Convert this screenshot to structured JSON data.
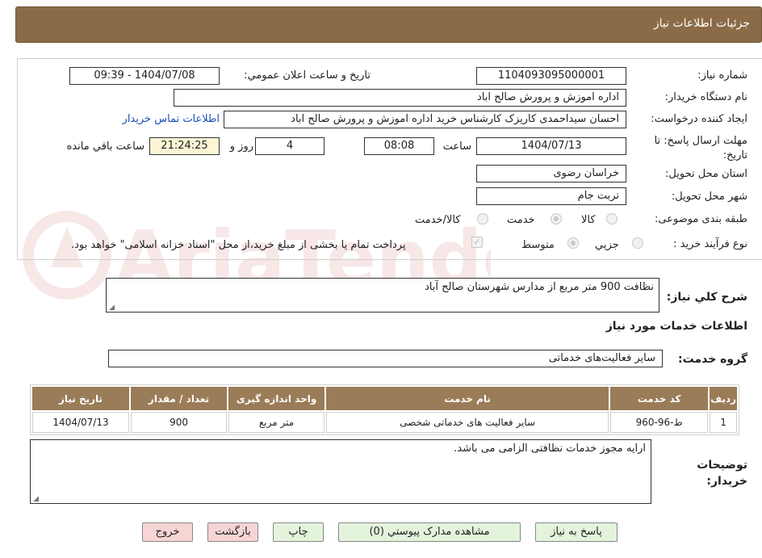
{
  "header": {
    "title": "جزئیات اطلاعات نیاز"
  },
  "labels": {
    "need_number": "شماره نیاز:",
    "announce_datetime": "تاریخ و ساعت اعلان عمومي:",
    "buyer_org": "نام دستگاه خريدار:",
    "requester": "ايجاد کننده درخواست:",
    "deadline": "مهلت ارسال پاسخ: تا تاریخ:",
    "hour": "ساعت",
    "day_and": "روز و",
    "remaining": "ساعت باقي مانده",
    "province": "استان محل تحويل:",
    "city": "شهر محل تحويل:",
    "category": "طبقه بندی موضوعی:",
    "purchase_type": "نوع فرآيند خريد :",
    "summary": "شرح کلي نياز:",
    "services_info": "اطلاعات خدمات مورد نياز",
    "service_group": "گروه خدمت:",
    "buyer_notes": "توضيحات خريدار:"
  },
  "fields": {
    "need_number": "1104093095000001",
    "announce_datetime": "1404/07/08 - 09:39",
    "buyer_org": "اداره اموزش و پرورش صالح اباد",
    "requester": "احسان سیداحمدی کاریزک کارشناس خرید اداره اموزش و پرورش صالح اباد",
    "contact_link": "اطلاعات تماس خريدار",
    "deadline_date": "1404/07/13",
    "deadline_time": "08:08",
    "days": "4",
    "remaining_time": "21:24:25",
    "province": "خراسان رضوی",
    "city": "تربت جام",
    "summary": "نظافت 900 متر مربع از مدارس شهرستان صالح آباد",
    "service_group": "سایر فعالیت‌های خدماتی",
    "buyer_notes": "ارایه مجوز خدمات نظافتی الزامی می باشد."
  },
  "category_options": [
    "کالا",
    "خدمت",
    "کالا/خدمت"
  ],
  "category_selected": "خدمت",
  "purchase_options": [
    "جزيي",
    "متوسط"
  ],
  "purchase_selected": "متوسط",
  "treasury_text": "پرداخت تمام يا بخشی از مبلغ خريد،از محل \"اسناد خزانه اسلامی\" خواهد بود.",
  "table": {
    "headers": [
      "رديف",
      "کد خدمت",
      "نام خدمت",
      "واحد اندازه گيری",
      "تعداد / مقدار",
      "تاريخ نياز"
    ],
    "rows": [
      [
        "1",
        "ط-96-960",
        "سایر فعالیت های خدماتی شخصی",
        "متر مربع",
        "900",
        "1404/07/13"
      ]
    ]
  },
  "buttons": {
    "reply": "پاسخ به نياز",
    "attachments": "مشاهده مدارک پيوستي (0)",
    "print": "چاپ",
    "back": "بازگشت",
    "exit": "خروج"
  },
  "watermark_text": "AriaTender.neT",
  "colors": {
    "header_bg": "#8b6b47",
    "table_header_bg": "#9b7c58",
    "button_green": "#e4f4dc",
    "button_red": "#f7d5d5",
    "link": "#1a4fb8"
  }
}
